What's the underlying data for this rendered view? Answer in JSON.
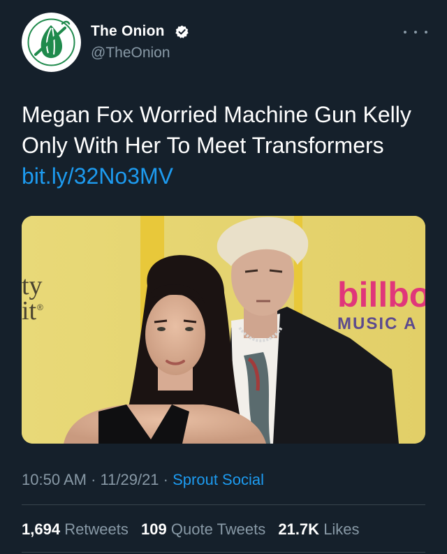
{
  "author": {
    "display_name": "The Onion",
    "handle": "@TheOnion",
    "verified": true
  },
  "tweet": {
    "text": "Megan Fox Worried Machine Gun Kelly Only With Her To Meet Transformers",
    "link": "bit.ly/32No3MV"
  },
  "media": {
    "sign_left": [
      "ty",
      "it"
    ],
    "sign_left_mark": "®",
    "sign_right_brand": "billbo",
    "sign_right_sub": "MUSIC A"
  },
  "meta": {
    "time": "10:50 AM",
    "date": "11/29/21",
    "separator": "·",
    "source": "Sprout Social"
  },
  "stats": {
    "retweets_count": "1,694",
    "retweets_label": "Retweets",
    "quotes_count": "109",
    "quotes_label": "Quote Tweets",
    "likes_count": "21.7K",
    "likes_label": "Likes"
  },
  "colors": {
    "background": "#15202b",
    "link": "#1d9bf0",
    "secondary_text": "#8899a6",
    "onion_green": "#1f8a4c",
    "backdrop_yellow": "#e6d26a"
  },
  "icons": {
    "avatar": "onion-logo-icon",
    "verified": "verified-badge-icon",
    "more": "more-options-icon"
  }
}
